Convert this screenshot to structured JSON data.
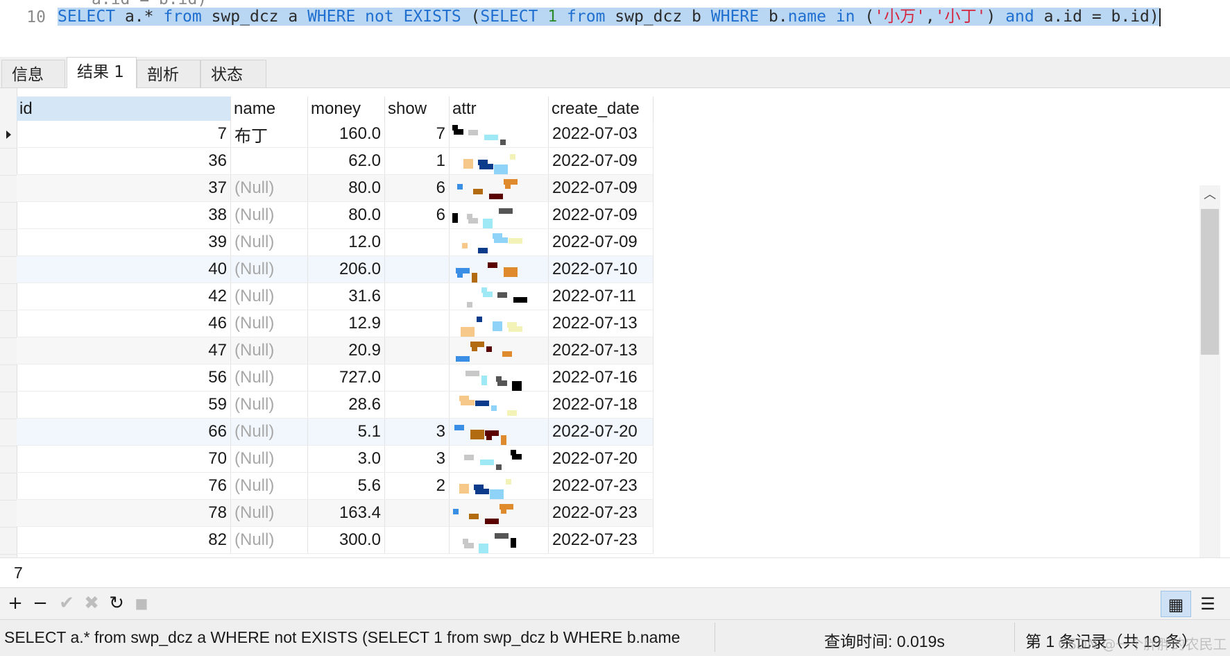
{
  "editor": {
    "prev_line_fragment": "a.id = b.id)",
    "line_number": "10",
    "sql_tokens": [
      {
        "t": "SELECT",
        "c": "kw"
      },
      {
        "t": " a.* ",
        "c": "plain"
      },
      {
        "t": "from",
        "c": "kw"
      },
      {
        "t": " swp_dcz a ",
        "c": "plain"
      },
      {
        "t": "WHERE",
        "c": "kw"
      },
      {
        "t": " ",
        "c": "plain"
      },
      {
        "t": "not",
        "c": "kw"
      },
      {
        "t": " ",
        "c": "plain"
      },
      {
        "t": "EXISTS",
        "c": "kw"
      },
      {
        "t": " (",
        "c": "plain"
      },
      {
        "t": "SELECT",
        "c": "kw"
      },
      {
        "t": " ",
        "c": "plain"
      },
      {
        "t": "1",
        "c": "num"
      },
      {
        "t": " ",
        "c": "plain"
      },
      {
        "t": "from",
        "c": "kw"
      },
      {
        "t": " swp_dcz b ",
        "c": "plain"
      },
      {
        "t": "WHERE",
        "c": "kw"
      },
      {
        "t": " b.",
        "c": "plain"
      },
      {
        "t": "name",
        "c": "kw"
      },
      {
        "t": " ",
        "c": "plain"
      },
      {
        "t": "in",
        "c": "kw"
      },
      {
        "t": " (",
        "c": "plain"
      },
      {
        "t": "'小万'",
        "c": "str"
      },
      {
        "t": ",",
        "c": "plain"
      },
      {
        "t": "'小丁'",
        "c": "str"
      },
      {
        "t": ") ",
        "c": "plain"
      },
      {
        "t": "and",
        "c": "kw"
      },
      {
        "t": " a.id = b.id)",
        "c": "plain"
      }
    ]
  },
  "tabs": [
    {
      "label": "信息",
      "active": false
    },
    {
      "label": "结果 1",
      "active": true
    },
    {
      "label": "剖析",
      "active": false
    },
    {
      "label": "状态",
      "active": false
    }
  ],
  "grid": {
    "columns": [
      "id",
      "name",
      "money",
      "show",
      "attr",
      "create_date"
    ],
    "null_text": "(Null)",
    "rows": [
      {
        "id": "7",
        "name": "布丁",
        "money": "160.0",
        "show": "7",
        "date": "2022-07-03"
      },
      {
        "id": "36",
        "name": "",
        "money": "62.0",
        "show": "1",
        "date": "2022-07-09"
      },
      {
        "id": "37",
        "name": null,
        "money": "80.0",
        "show": "6",
        "date": "2022-07-09"
      },
      {
        "id": "38",
        "name": null,
        "money": "80.0",
        "show": "6",
        "date": "2022-07-09"
      },
      {
        "id": "39",
        "name": null,
        "money": "12.0",
        "show": "",
        "date": "2022-07-09"
      },
      {
        "id": "40",
        "name": null,
        "money": "206.0",
        "show": "",
        "date": "2022-07-10"
      },
      {
        "id": "42",
        "name": null,
        "money": "31.6",
        "show": "",
        "date": "2022-07-11"
      },
      {
        "id": "46",
        "name": null,
        "money": "12.9",
        "show": "",
        "date": "2022-07-13"
      },
      {
        "id": "47",
        "name": null,
        "money": "20.9",
        "show": "",
        "date": "2022-07-13"
      },
      {
        "id": "56",
        "name": null,
        "money": "727.0",
        "show": "",
        "date": "2022-07-16"
      },
      {
        "id": "59",
        "name": null,
        "money": "28.6",
        "show": "",
        "date": "2022-07-18"
      },
      {
        "id": "66",
        "name": null,
        "money": "5.1",
        "show": "3",
        "date": "2022-07-20"
      },
      {
        "id": "70",
        "name": null,
        "money": "3.0",
        "show": "3",
        "date": "2022-07-20"
      },
      {
        "id": "76",
        "name": null,
        "money": "5.6",
        "show": "2",
        "date": "2022-07-23"
      },
      {
        "id": "78",
        "name": null,
        "money": "163.4",
        "show": "",
        "date": "2022-07-23"
      },
      {
        "id": "82",
        "name": null,
        "money": "300.0",
        "show": "",
        "date": "2022-07-23"
      }
    ]
  },
  "preview": {
    "value": "7"
  },
  "toolbar": {
    "add": "+",
    "remove": "−",
    "apply": "✔",
    "cancel": "✖",
    "refresh": "↻",
    "stop": "■"
  },
  "status": {
    "sql": "SELECT a.* from swp_dcz a WHERE not EXISTS (SELECT 1 from swp_dcz b WHERE b.name",
    "query_time": "查询时间: 0.019s",
    "records": "第 1 条记录（共 19 条）",
    "watermark": "CSDN @一个胖胖的农民工"
  },
  "colors": {
    "selection": "#b9d6f2",
    "keyword": "#1f6fd0",
    "string": "#d6243c",
    "number": "#2e8b2e",
    "null": "#a8a8a8"
  }
}
